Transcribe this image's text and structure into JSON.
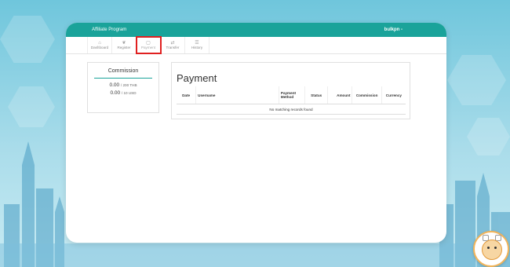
{
  "header": {
    "title": "Affiliate Program",
    "user": "bulkpn -"
  },
  "nav": {
    "items": [
      {
        "label": "Dashboard",
        "icon": "⌂",
        "name": "tab-dashboard"
      },
      {
        "label": "Register",
        "icon": "❦",
        "name": "tab-register"
      },
      {
        "label": "Payment",
        "icon": "▢",
        "name": "tab-payment",
        "active": true
      },
      {
        "label": "Transfer",
        "icon": "⇄",
        "name": "tab-transfer"
      },
      {
        "label": "History",
        "icon": "☰",
        "name": "tab-history"
      }
    ]
  },
  "commission": {
    "title": "Commission",
    "thb": {
      "value": "0.00",
      "limit": "/ 200 THB"
    },
    "usd": {
      "value": "0.00",
      "limit": "/ 10 USD"
    }
  },
  "payment": {
    "title": "Payment",
    "columns": [
      "Date",
      "Username",
      "Payment Method",
      "Status",
      "Amount",
      "Commission",
      "Currency"
    ],
    "empty_text": "No matching records found"
  },
  "colors": {
    "accent": "#1aa39a",
    "highlight": "#e02020"
  }
}
